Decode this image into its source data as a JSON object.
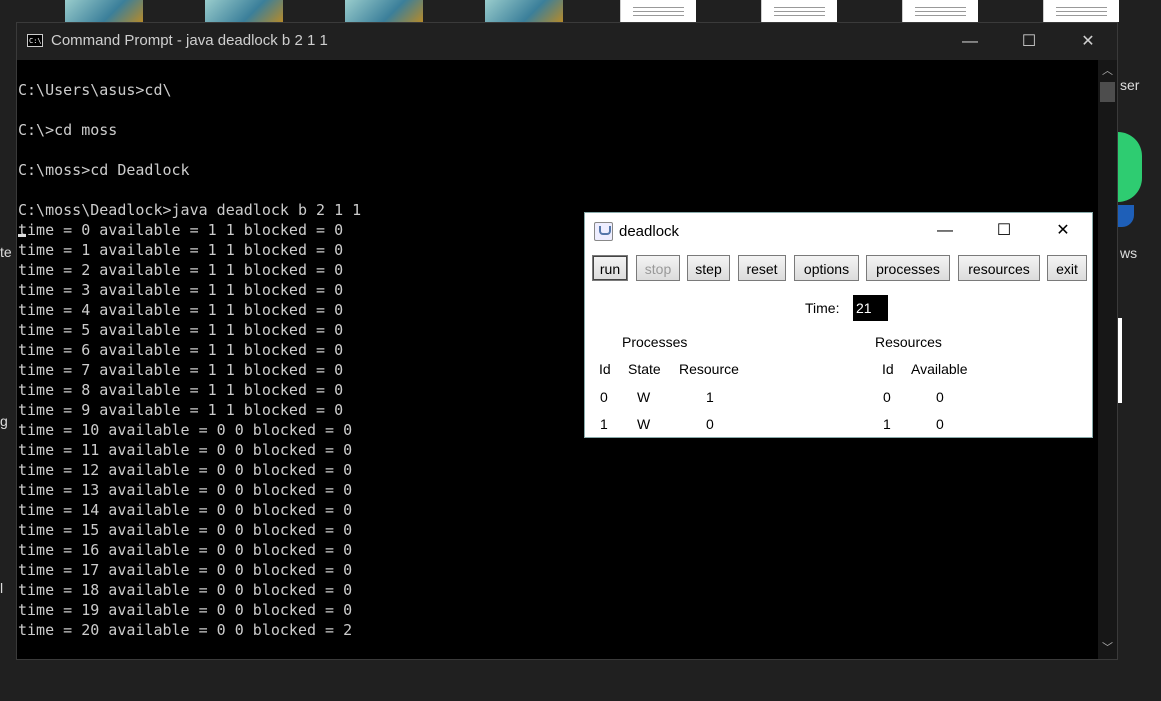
{
  "desktop": {
    "side_labels": [
      "ser",
      "te",
      "ws",
      "g",
      "l"
    ]
  },
  "console": {
    "title": "Command Prompt - java  deadlock b 2 1 1",
    "icon_text": "C:\\",
    "controls": {
      "minimize": "—",
      "maximize": "☐",
      "close": "✕"
    },
    "lines": [
      "C:\\Users\\asus>cd\\",
      "",
      "C:\\>cd moss",
      "",
      "C:\\moss>cd Deadlock",
      "",
      "C:\\moss\\Deadlock>java deadlock b 2 1 1",
      "time = 0 available = 1 1 blocked = 0",
      "time = 1 available = 1 1 blocked = 0",
      "time = 2 available = 1 1 blocked = 0",
      "time = 3 available = 1 1 blocked = 0",
      "time = 4 available = 1 1 blocked = 0",
      "time = 5 available = 1 1 blocked = 0",
      "time = 6 available = 1 1 blocked = 0",
      "time = 7 available = 1 1 blocked = 0",
      "time = 8 available = 1 1 blocked = 0",
      "time = 9 available = 1 1 blocked = 0",
      "time = 10 available = 0 0 blocked = 0",
      "time = 11 available = 0 0 blocked = 0",
      "time = 12 available = 0 0 blocked = 0",
      "time = 13 available = 0 0 blocked = 0",
      "time = 14 available = 0 0 blocked = 0",
      "time = 15 available = 0 0 blocked = 0",
      "time = 16 available = 0 0 blocked = 0",
      "time = 17 available = 0 0 blocked = 0",
      "time = 18 available = 0 0 blocked = 0",
      "time = 19 available = 0 0 blocked = 0",
      "time = 20 available = 0 0 blocked = 2"
    ]
  },
  "deadlock": {
    "title": "deadlock",
    "controls": {
      "minimize": "—",
      "maximize": "☐",
      "close": "✕"
    },
    "buttons": [
      "run",
      "stop",
      "step",
      "reset",
      "options",
      "processes",
      "resources",
      "exit"
    ],
    "time_label": "Time:",
    "time_value": "21",
    "processes": {
      "heading": "Processes",
      "columns": [
        "Id",
        "State",
        "Resource"
      ],
      "rows": [
        [
          "0",
          "W",
          "1"
        ],
        [
          "1",
          "W",
          "0"
        ]
      ]
    },
    "resources": {
      "heading": "Resources",
      "columns": [
        "Id",
        "Available"
      ],
      "rows": [
        [
          "0",
          "0"
        ],
        [
          "1",
          "0"
        ]
      ]
    }
  }
}
